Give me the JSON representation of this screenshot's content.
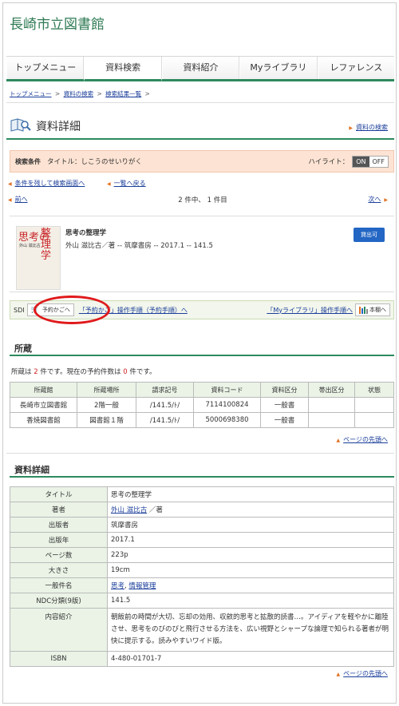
{
  "site": {
    "title": "長崎市立図書館"
  },
  "nav": {
    "items": [
      {
        "label": "トップメニュー"
      },
      {
        "label": "資料検索"
      },
      {
        "label": "資料紹介"
      },
      {
        "label": "Myライブラリ"
      },
      {
        "label": "レファレンス"
      }
    ]
  },
  "breadcrumb": {
    "items": [
      "トップメニュー",
      "資料の検索",
      "検索結果一覧"
    ],
    "separator": ">"
  },
  "page": {
    "title": "資料詳細",
    "search_link": "資料の検索"
  },
  "condition": {
    "label": "検索条件",
    "text": "タイトル：しこうのせいりがく",
    "highlight_label": "ハイライト：",
    "on": "ON",
    "off": "OFF"
  },
  "links": {
    "back_to_search": "条件を残して検索画面へ",
    "back_to_list": "一覧へ戻る",
    "prev": "前へ",
    "next": "次へ",
    "count": "2 件中、 1 件目"
  },
  "record": {
    "cover_title_a": "思考の",
    "cover_title_b": "整理学",
    "cover_author": "外山 滋比古",
    "title": "思考の整理学",
    "detail": "外山 滋比古／著 -- 筑摩書房 -- 2017.1 -- 141.5",
    "status": "貸出可"
  },
  "actions": {
    "sdi": "SDI",
    "reserve": "予約かごへ",
    "reserve_guide": "「予約かご」操作手順（予約手順）へ",
    "mylib_guide": "「Myライブラリ」操作手順へ",
    "shelf": "本棚へ"
  },
  "holdings": {
    "title": "所蔵",
    "note_prefix": "所蔵は",
    "count": "2",
    "note_mid": "件です。現在の予約件数は",
    "reserve_count": "0",
    "note_suffix": "件です。",
    "headers": [
      "所蔵館",
      "所蔵場所",
      "請求記号",
      "資料コード",
      "資料区分",
      "帯出区分",
      "状態"
    ],
    "rows": [
      [
        "長崎市立図書館",
        "2階一般",
        "/141.5/ﾄ/",
        "7114100824",
        "一般書",
        "",
        ""
      ],
      [
        "香焼図書館",
        "図書館１階",
        "/141.5/ﾄ/",
        "5000698380",
        "一般書",
        "",
        ""
      ]
    ]
  },
  "details": {
    "title": "資料詳細",
    "rows": {
      "title_label": "タイトル",
      "title_value": "思考の整理学",
      "author_label": "著者",
      "author_link": "外山 滋比古",
      "author_suffix": "／著",
      "publisher_label": "出版者",
      "publisher_value": "筑摩書房",
      "year_label": "出版年",
      "year_value": "2017.1",
      "pages_label": "ページ数",
      "pages_value": "223p",
      "size_label": "大きさ",
      "size_value": "19cm",
      "subject_label": "一般件名",
      "subject_link_1": "思考",
      "subject_sep": ",",
      "subject_link_2": "情報管理",
      "ndc_label": "NDC分類(9版)",
      "ndc_value": "141.5",
      "summary_label": "内容紹介",
      "summary_value": "朝飯前の時間が大切、忘却の効用、収斂的思考と拡散的読書…。アイディアを軽やかに離陸させ、思考をのびのびと飛行させる方法を、広い視野とシャープな論理で知られる著者が明快に提示する。読みやすいワイド版。",
      "isbn_label": "ISBN",
      "isbn_value": "4-480-01701-7"
    }
  },
  "page_top": "ページの先頭へ",
  "colors": {
    "accent": "#2e8a5e",
    "link": "#1a3e9a",
    "status": "#2366c4",
    "highlight": "#e0191b"
  }
}
